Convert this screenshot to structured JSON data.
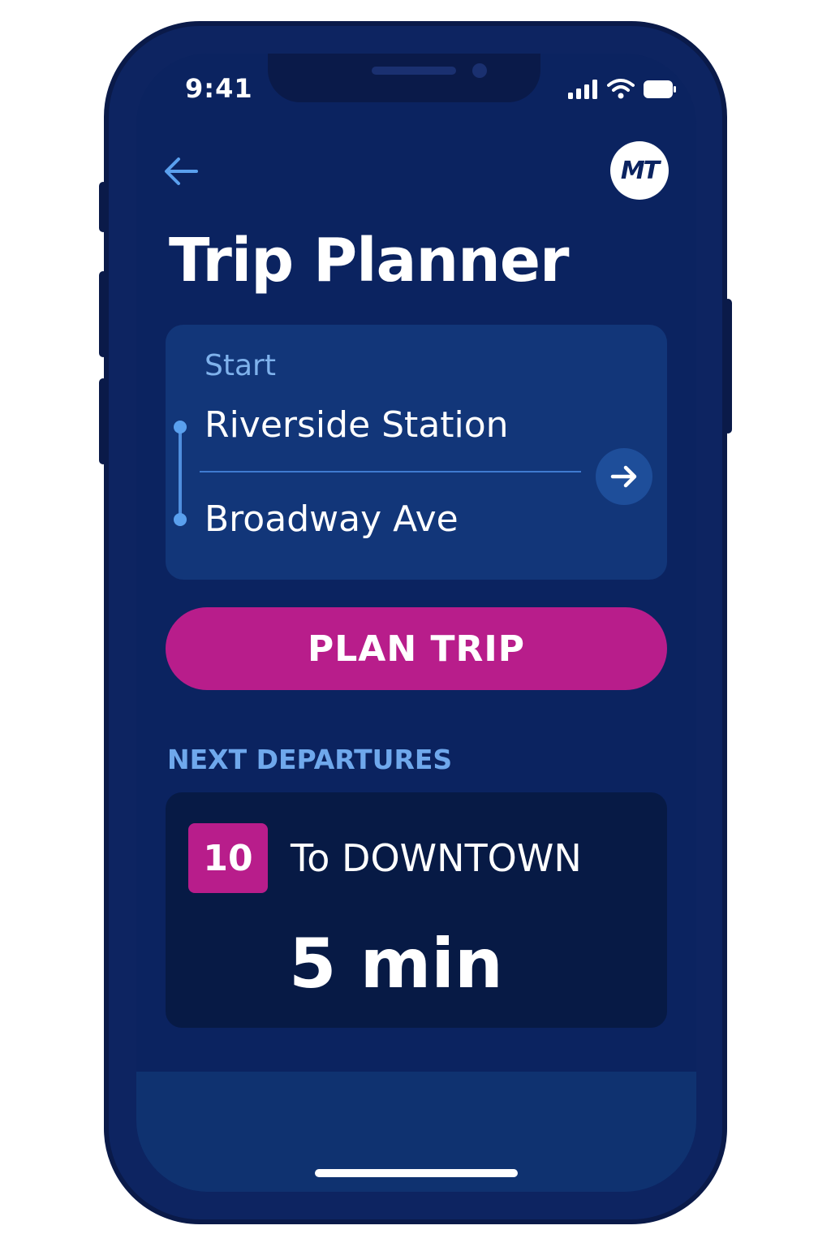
{
  "status_bar": {
    "time": "9:41",
    "icons": [
      "signal-icon",
      "wifi-icon",
      "battery-icon"
    ]
  },
  "header": {
    "back_icon": "arrow-left-icon",
    "logo_text": "MT"
  },
  "page": {
    "title": "Trip Planner"
  },
  "route": {
    "start_label": "Start",
    "origin": "Riverside Station",
    "destination": "Broadway Ave",
    "swap_icon": "arrow-right-icon"
  },
  "actions": {
    "plan_trip_label": "PLAN TRIP"
  },
  "departures": {
    "section_label": "NEXT DEPARTURES",
    "items": [
      {
        "route_number": "10",
        "destination": "To DOWNTOWN",
        "eta": "5 min"
      }
    ]
  },
  "colors": {
    "background": "#0b2360",
    "card": "#123679",
    "accent": "#b81d8b",
    "label_blue": "#7fb2ec",
    "departure_card": "#071a45"
  }
}
